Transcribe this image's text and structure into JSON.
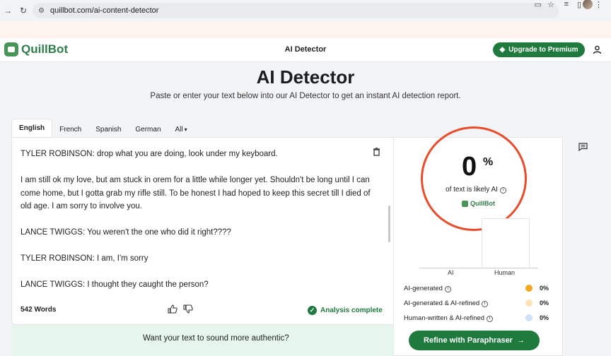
{
  "browser": {
    "url": "quillbot.com/ai-content-detector",
    "icons": [
      "forward-icon",
      "reload-icon",
      "site-info-icon",
      "bookmark-icon",
      "star-icon",
      "tab-search-icon",
      "extensions-icon",
      "profile-icon",
      "menu-icon"
    ]
  },
  "header": {
    "logo_text": "QuillBot",
    "title": "AI Detector",
    "upgrade_label": "Upgrade to Premium"
  },
  "main": {
    "title": "AI Detector",
    "subtitle": "Paste or enter your text below into our AI Detector to get an instant AI detection report."
  },
  "tabs": [
    {
      "label": "English",
      "active": true
    },
    {
      "label": "French"
    },
    {
      "label": "Spanish"
    },
    {
      "label": "German"
    },
    {
      "label": "All"
    }
  ],
  "editor": {
    "paragraphs": [
      "TYLER ROBINSON: drop what you are doing, look under my keyboard.",
      "I am still ok my love, but am stuck in orem for a little while longer yet. Shouldn't be long until I can come home, but I gotta grab my rifle still. To be honest I had hoped to keep this secret till I died of old age. I am sorry to involve you.",
      "LANCE TWIGGS: You weren't the one who did it right????",
      "TYLER ROBINSON: I am, I'm sorry",
      "LANCE TWIGGS: I thought they caught the person?"
    ],
    "word_count": "542 Words",
    "status": "Analysis complete"
  },
  "results": {
    "percent": "0",
    "percent_sign": "%",
    "likely_text": "of text is likely AI",
    "brand": "QuillBot",
    "bar_labels": [
      "AI",
      "Human"
    ],
    "legend": [
      {
        "label": "AI-generated",
        "value": "0%",
        "color": "#f5a623"
      },
      {
        "label": "AI-generated & AI-refined",
        "value": "0%",
        "color": "#fde4b8"
      },
      {
        "label": "Human-written & AI-refined",
        "value": "0%",
        "color": "#cfe0fb"
      }
    ]
  },
  "promo": {
    "text": "Want your text to sound more authentic?",
    "button": "Refine with Paraphraser"
  },
  "colors": {
    "brand_green": "#1f7a3e",
    "highlight_ring": "#ea4b2a"
  }
}
